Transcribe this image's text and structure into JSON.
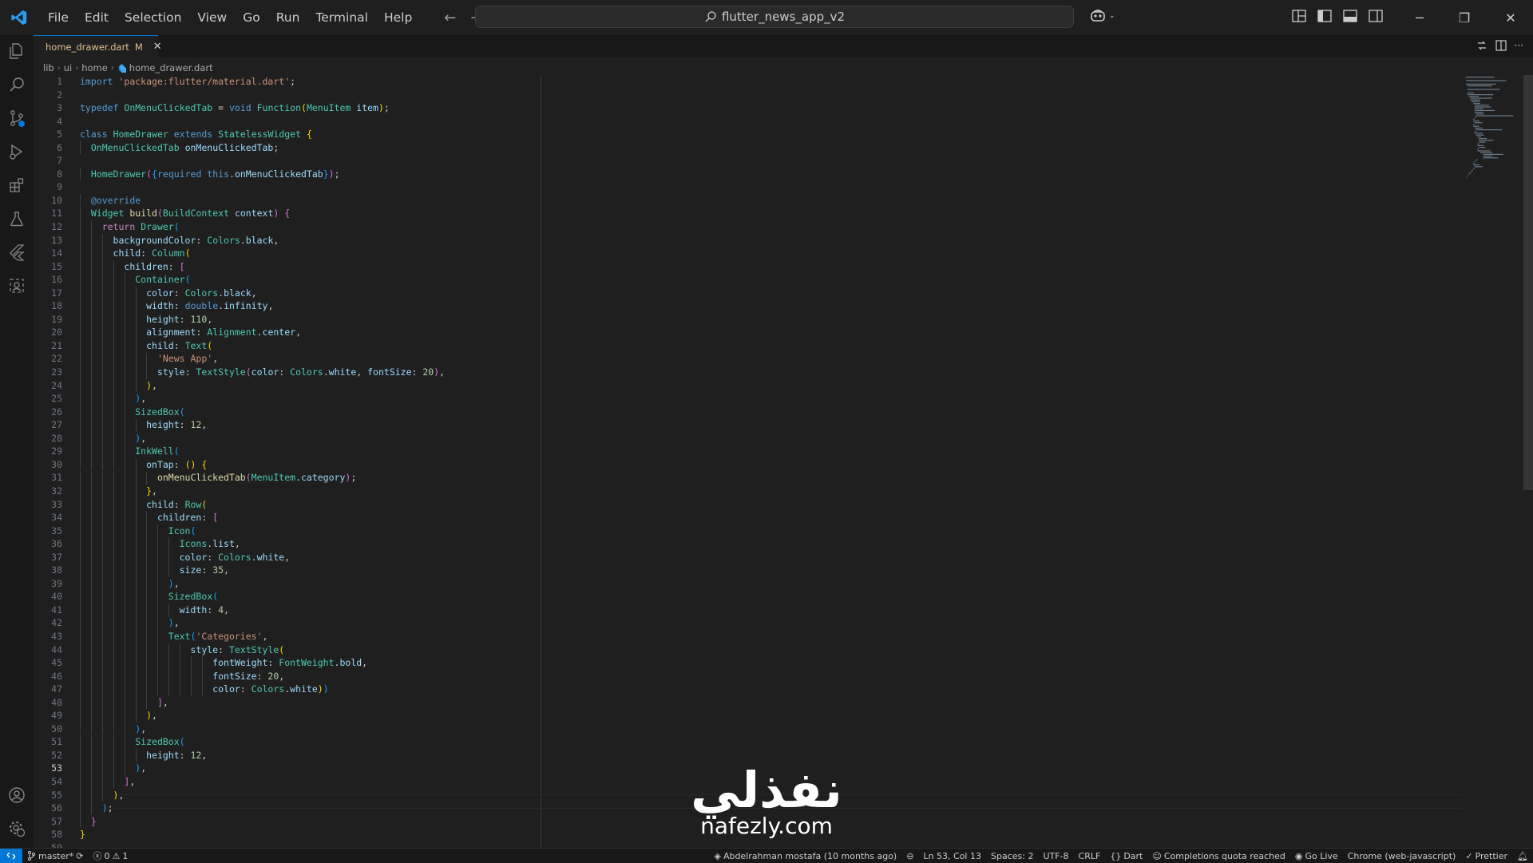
{
  "titlebar": {
    "menu": [
      "File",
      "Edit",
      "Selection",
      "View",
      "Go",
      "Run",
      "Terminal",
      "Help"
    ],
    "search_text": "flutter_news_app_v2"
  },
  "tab": {
    "filename": "home_drawer.dart",
    "modified_marker": "M",
    "close_glyph": "✕"
  },
  "breadcrumb": [
    "lib",
    "ui",
    "home",
    "home_drawer.dart"
  ],
  "editor": {
    "current_line": 53,
    "lines": [
      "import 'package:flutter/material.dart';",
      "",
      "typedef OnMenuClickedTab = void Function(MenuItem item);",
      "",
      "class HomeDrawer extends StatelessWidget {",
      "  OnMenuClickedTab onMenuClickedTab;",
      "",
      "  HomeDrawer({required this.onMenuClickedTab});",
      "",
      "  @override",
      "  Widget build(BuildContext context) {",
      "    return Drawer(",
      "      backgroundColor: Colors.black,",
      "      child: Column(",
      "        children: [",
      "          Container(",
      "            color: Colors.black,",
      "            width: double.infinity,",
      "            height: 110,",
      "            alignment: Alignment.center,",
      "            child: Text(",
      "              'News App',",
      "              style: TextStyle(color: Colors.white, fontSize: 20),",
      "            ),",
      "          ),",
      "          SizedBox(",
      "            height: 12,",
      "          ),",
      "          InkWell(",
      "            onTap: () {",
      "              onMenuClickedTab(MenuItem.category);",
      "            },",
      "            child: Row(",
      "              children: [",
      "                Icon(",
      "                  Icons.list,",
      "                  color: Colors.white,",
      "                  size: 35,",
      "                ),",
      "                SizedBox(",
      "                  width: 4,",
      "                ),",
      "                Text('Categories',",
      "                    style: TextStyle(",
      "                        fontWeight: FontWeight.bold,",
      "                        fontSize: 20,",
      "                        color: Colors.white))",
      "              ],",
      "            ),",
      "          ),",
      "          SizedBox(",
      "            height: 12,",
      "          ),",
      "        ],",
      "      ),",
      "    );",
      "  }",
      "}",
      ""
    ]
  },
  "watermark": {
    "arabic": "نفذلي",
    "latin": "nafezly.com"
  },
  "statusbar": {
    "branch": "master*",
    "errors": "0",
    "warnings": "1",
    "blame": "Abdelrahman mostafa (10 months ago)",
    "position": "Ln 53, Col 13",
    "spaces": "Spaces: 2",
    "encoding": "UTF-8",
    "eol": "CRLF",
    "language": "Dart",
    "copilot": "Completions quota reached",
    "golive": "Go Live",
    "device": "Chrome (web-javascript)",
    "prettier": "Prettier"
  },
  "colors": {
    "accent": "#0078d4",
    "background": "#1f1f1f",
    "modified": "#e2c08d"
  },
  "icons": {
    "activity": [
      "explorer-icon",
      "search-icon",
      "source-control-icon",
      "run-debug-icon",
      "extensions-icon",
      "testing-icon",
      "flutter-icon",
      "remote-explorer-icon",
      "accounts-icon",
      "manage-gear-icon"
    ]
  }
}
